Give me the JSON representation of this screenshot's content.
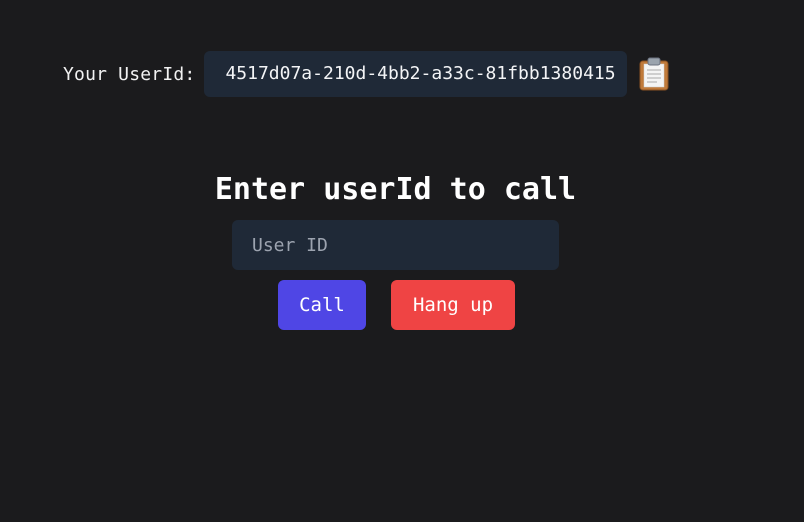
{
  "user": {
    "label": "Your UserId:",
    "id": "4517d07a-210d-4bb2-a33c-81fbb1380415",
    "copy_icon": "clipboard-icon"
  },
  "call": {
    "heading": "Enter userId to call",
    "input_placeholder": "User ID",
    "input_value": "",
    "call_label": "Call",
    "hangup_label": "Hang up"
  },
  "colors": {
    "background": "#1b1b1d",
    "field": "#1f2937",
    "call_button": "#4f46e5",
    "hangup_button": "#ef4444"
  }
}
